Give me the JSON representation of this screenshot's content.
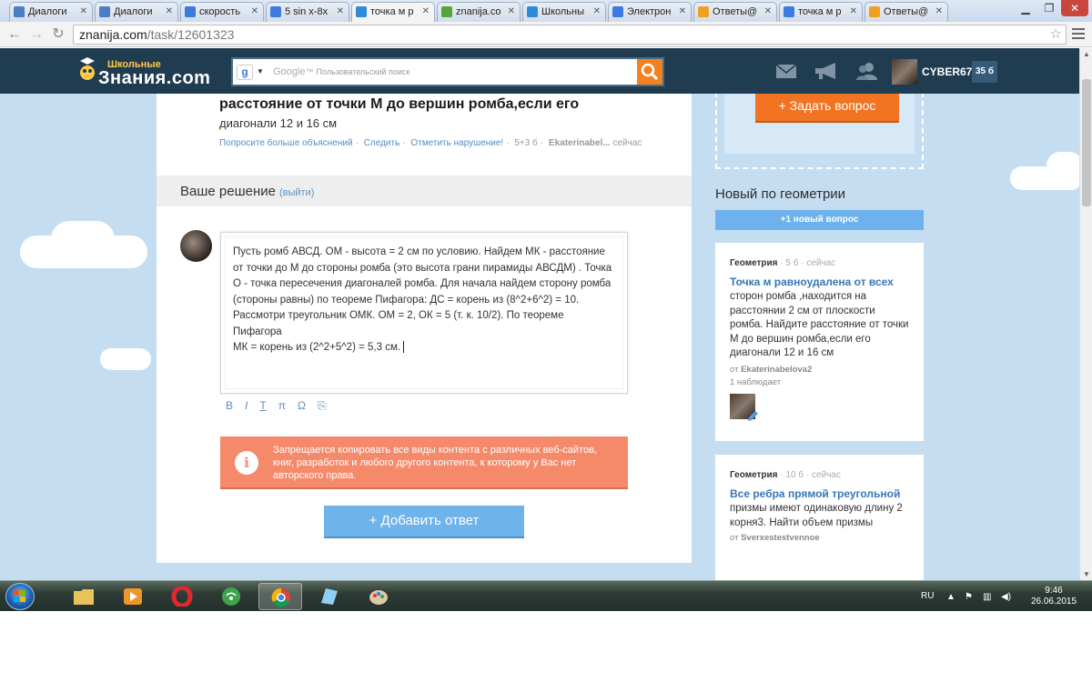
{
  "tabs": [
    {
      "label": "Диалоги",
      "icon": "chat-favicon-icon",
      "color": "#4a7fc1",
      "active": false
    },
    {
      "label": "Диалоги",
      "icon": "chat-favicon-icon",
      "color": "#4a7fc1",
      "active": false
    },
    {
      "label": "скорость",
      "icon": "google-favicon-icon",
      "color": "#3b7ae0",
      "active": false
    },
    {
      "label": "5 sin x-8x",
      "icon": "google-favicon-icon",
      "color": "#3b7ae0",
      "active": false
    },
    {
      "label": "точка м р",
      "icon": "znanija-favicon-icon",
      "color": "#2f8ad8",
      "active": true
    },
    {
      "label": "znanija.co",
      "icon": "chrome-favicon-icon",
      "color": "#5aa23a",
      "active": false
    },
    {
      "label": "Школьны",
      "icon": "znanija-favicon-icon",
      "color": "#2f8ad8",
      "active": false
    },
    {
      "label": "Электрон",
      "icon": "google-favicon-icon",
      "color": "#3b7ae0",
      "active": false
    },
    {
      "label": "Ответы@",
      "icon": "answers-favicon-icon",
      "color": "#f0a020",
      "active": false
    },
    {
      "label": "точка м р",
      "icon": "google-favicon-icon",
      "color": "#3b7ae0",
      "active": false
    },
    {
      "label": "Ответы@",
      "icon": "answers-favicon-icon",
      "color": "#f0a020",
      "active": false
    }
  ],
  "address": {
    "domain": "znanija.com",
    "path": "/task/12601323"
  },
  "header": {
    "logo_top": "Школьные",
    "logo_main": "Знания.com",
    "search_brand": "Google",
    "search_brand_tm": "™",
    "search_placeholder": "Пользовательский поиск",
    "username": "CYBER67",
    "points": "35 б"
  },
  "question": {
    "title": "расстояние от точки М до вершин ромба,если его",
    "subtitle": "диагонали 12 и 16 см",
    "actions": [
      "Попросите больше объяснений",
      "Следить",
      "Отметить нарушение!"
    ],
    "points": "5+3 б",
    "author": "Ekaterinabel...",
    "time": "сейчас"
  },
  "solution": {
    "heading": "Ваше решение",
    "exit_label": "(выйти)",
    "answer_lines": [
      "Пусть ромб АВСД. ОМ - высота = 2 см по условию. Найдем МК - расстояние",
      "от точки до М до стороны ромба (это высота грани пирамиды АВСДМ) . Точка",
      "О - точка пересечения диагоналей ромба. Для начала найдем сторону ромба",
      "(стороны равны) по теореме Пифагора: ДС = корень из (8^2+6^2) = 10.",
      "Рассмотри треугольник ОМК. ОМ = 2, ОК = 5 (т. к. 10/2). По теореме Пифагора",
      "МК = корень из (2^2+5^2) = 5,3 см."
    ],
    "toolbar": [
      "B",
      "I",
      "T",
      "π",
      "Ω",
      "⎘"
    ],
    "warning_icon": "i",
    "warning": "Запрещается копировать все виды контента с различных веб-сайтов, книг, разработок и любого другого контента, к которому у Вас нет авторского права.",
    "add_button": "+ Добавить ответ"
  },
  "sidebar": {
    "ask_button": "+ Задать вопрос",
    "new_title": "Новый по геометрии",
    "new_button": "+1 новый вопрос",
    "cards": [
      {
        "subject": "Геометрия",
        "points": "5 б",
        "time": "сейчас",
        "title": "Точка м равноудалена от всех",
        "body": [
          "сторон ромба ,находится на",
          "расстоянии 2 см от плоскости",
          "ромба. Найдите расстояние от точки",
          "М до вершин ромба,если его",
          "диагонали 12 и 16 см"
        ],
        "from_prefix": "от",
        "from": "Ekaterinabelova2",
        "watch": "1 наблюдает"
      },
      {
        "subject": "Геометрия",
        "points": "10 б",
        "time": "сейчас",
        "title": "Все ребра прямой треугольной",
        "body": [
          "призмы имеют одинаковую длину 2",
          "корня3. Найти объем призмы"
        ],
        "from_prefix": "от",
        "from": "Sverxestestvennoe"
      }
    ]
  },
  "taskbar": {
    "lang": "RU",
    "time": "9:46",
    "date": "26.06.2015"
  },
  "colors": {
    "header_bg": "#203c51",
    "page_bg": "#c5ddf1",
    "orange": "#f27422",
    "blue_button": "#6fb3eb",
    "warning_bg": "#f58a6b"
  }
}
